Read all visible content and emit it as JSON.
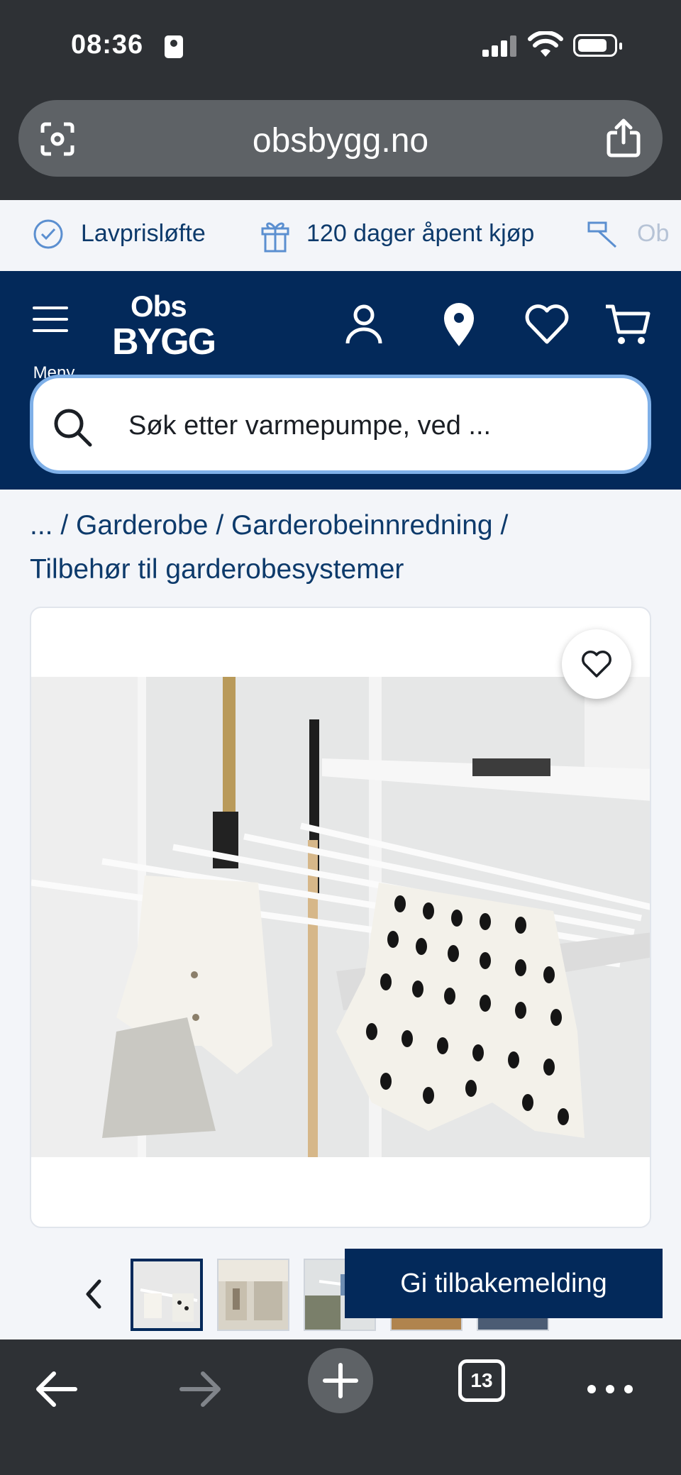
{
  "status_bar": {
    "time": "08:36"
  },
  "browser": {
    "url": "obsbygg.no",
    "tab_count": "13"
  },
  "usp_bar": {
    "items": [
      {
        "label": "Lavprisløfte",
        "icon": "check-badge-icon"
      },
      {
        "label": "120 dager åpent kjøp",
        "icon": "gift-icon"
      },
      {
        "label": "Ob",
        "icon": "hammer-icon"
      }
    ]
  },
  "header": {
    "menu_label": "Meny",
    "logo_top": "Obs",
    "logo_bottom": "BYGG",
    "search_placeholder": "Søk etter varmepumpe, ved ..."
  },
  "breadcrumb": {
    "items": [
      "...",
      "Garderobe",
      "Garderobeinnredning",
      "Tilbehør til garderobesystemer"
    ],
    "separator": "/"
  },
  "feedback": {
    "label": "Gi tilbakemelding"
  },
  "colors": {
    "brand_navy": "#03295a",
    "link_blue": "#0d3a6b",
    "search_border": "#7fb0e8",
    "chrome": "#2e3135"
  }
}
